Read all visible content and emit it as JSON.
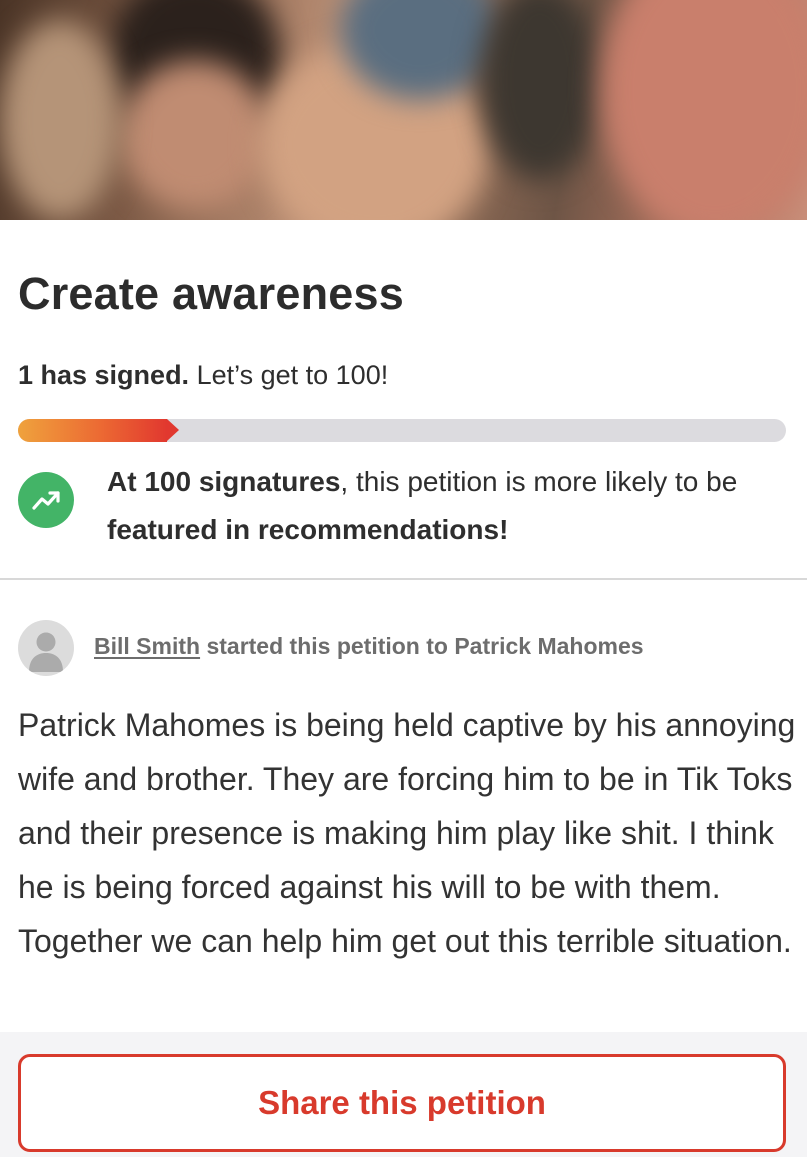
{
  "petition": {
    "title": "Create awareness",
    "signed_count": "1 has signed.",
    "goal_text": " Let’s get to 100!",
    "progress_fraction": 0.21
  },
  "milestone": {
    "icon": "trending-up-icon",
    "strong1": "At 100 signatures",
    "text1": ", this petition is more likely to be ",
    "strong2": "featured in recommendations!"
  },
  "starter": {
    "name": "Bill Smith",
    "text": " started this petition to Patrick Mahomes"
  },
  "description": "Patrick Mahomes is being held captive by his annoying wife and brother. They are forcing him to be in Tik Toks and their presence is making him play like shit. I think he is being forced against his will to be with them. Together we can help him get out this terrible situation.",
  "actions": {
    "share_label": "Share this petition"
  },
  "colors": {
    "accent": "#d83a2c",
    "milestone_green": "#43b467",
    "progress_track": "#dcdbdf"
  }
}
